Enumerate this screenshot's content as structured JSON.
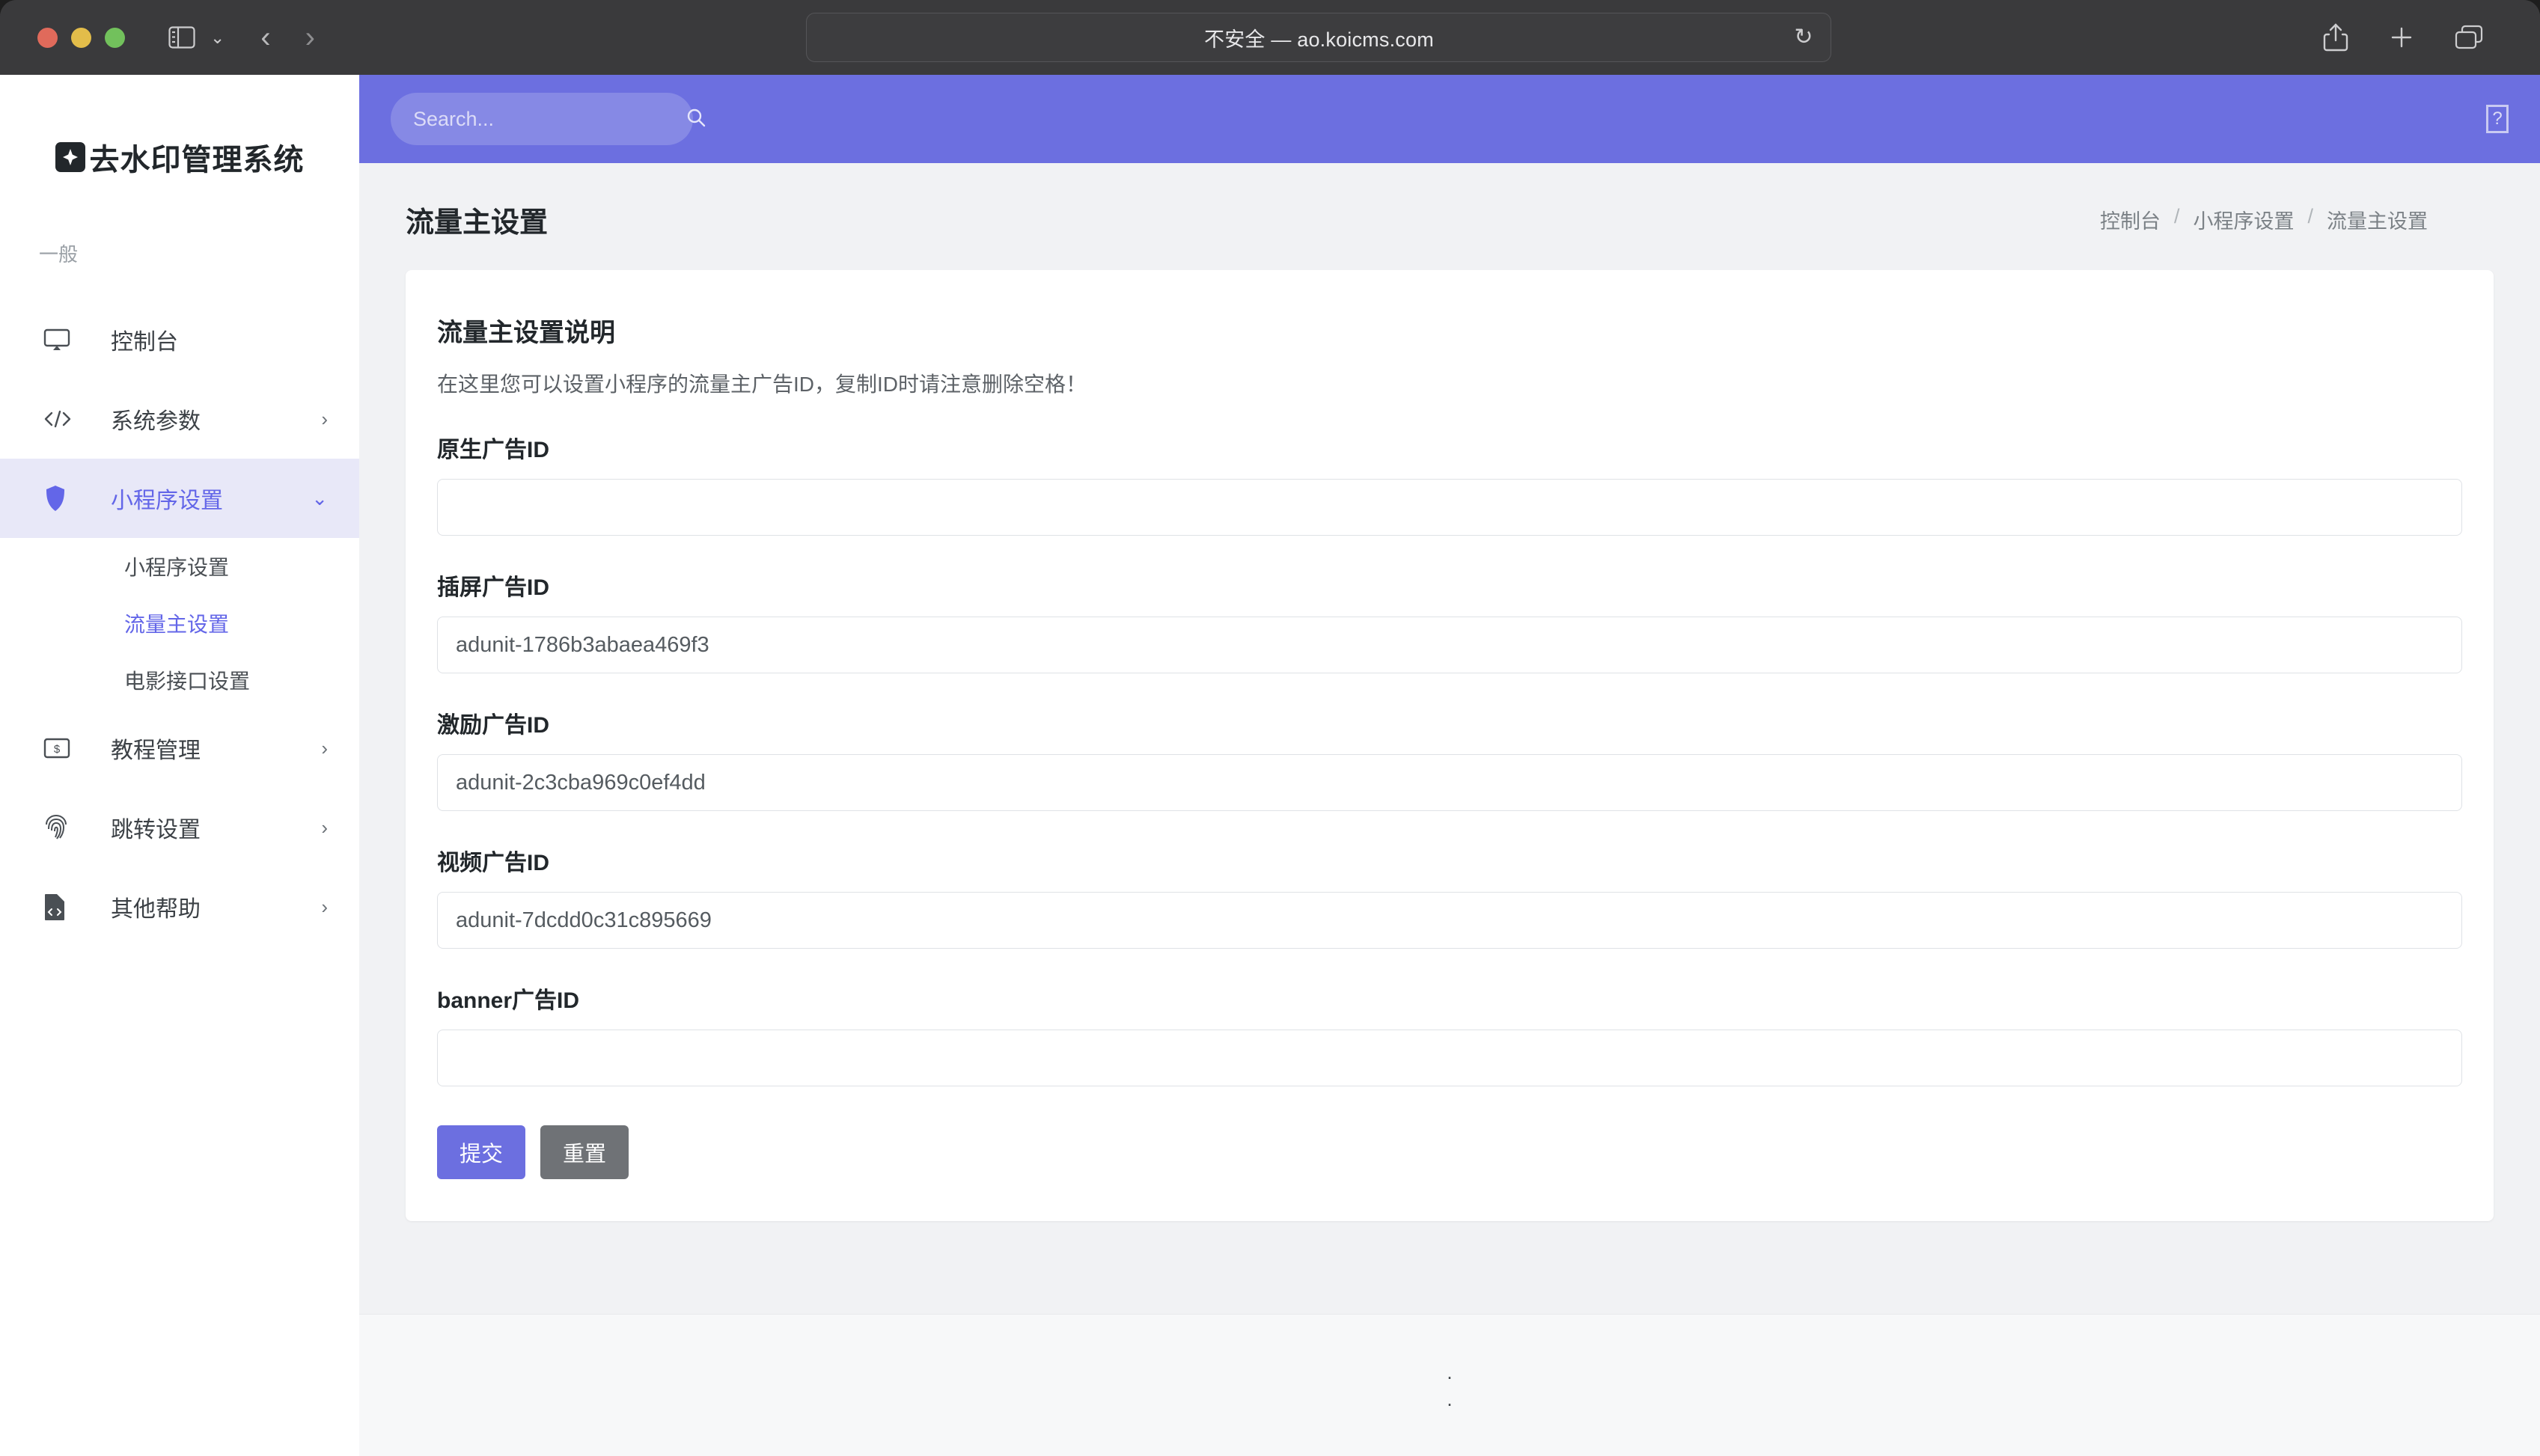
{
  "browser": {
    "url_text": "不安全 — ao.koicms.com",
    "icons": {
      "sidebar_toggle": "sidebar-toggle-icon",
      "chevron_down": "chevron-down-icon",
      "back": "‹",
      "forward": "›",
      "shield": "shield-icon",
      "reload": "↻",
      "share": "share-icon",
      "new_tab": "+",
      "tabs": "tab-overview-icon"
    }
  },
  "sidebar": {
    "brand": "去水印管理系统",
    "section_label": "一般",
    "items": [
      {
        "label": "控制台",
        "icon": "monitor-icon",
        "chevron": "",
        "active": false
      },
      {
        "label": "系统参数",
        "icon": "code-icon",
        "chevron": "›",
        "active": false
      },
      {
        "label": "小程序设置",
        "icon": "shield-icon",
        "chevron": "⌄",
        "active": true
      }
    ],
    "subitems": [
      {
        "label": "小程序设置",
        "active": false
      },
      {
        "label": "流量主设置",
        "active": true
      },
      {
        "label": "电影接口设置",
        "active": false
      }
    ],
    "items_after": [
      {
        "label": "教程管理",
        "icon": "money-card-icon",
        "chevron": "›",
        "active": false
      },
      {
        "label": "跳转设置",
        "icon": "fingerprint-icon",
        "chevron": "›",
        "active": false
      },
      {
        "label": "其他帮助",
        "icon": "file-code-icon",
        "chevron": "›",
        "active": false
      }
    ]
  },
  "topbar": {
    "search_placeholder": "Search...",
    "search_value": "",
    "missing_glyph": "?"
  },
  "header": {
    "title": "流量主设置",
    "breadcrumb": [
      "控制台",
      "小程序设置",
      "流量主设置"
    ],
    "breadcrumb_sep": "/"
  },
  "card": {
    "title": "流量主设置说明",
    "description": "在这里您可以设置小程序的流量主广告ID，复制ID时请注意删除空格！",
    "fields": [
      {
        "label": "原生广告ID",
        "value": "",
        "placeholder": ""
      },
      {
        "label": "插屏广告ID",
        "value": "adunit-1786b3abaea469f3",
        "placeholder": ""
      },
      {
        "label": "激励广告ID",
        "value": "adunit-2c3cba969c0ef4dd",
        "placeholder": ""
      },
      {
        "label": "视频广告ID",
        "value": "adunit-7dcdd0c31c895669",
        "placeholder": ""
      },
      {
        "label": "banner广告ID",
        "value": "",
        "placeholder": ""
      }
    ],
    "submit_label": "提交",
    "reset_label": "重置"
  },
  "footer": {
    "line1": ".",
    "line2": "."
  },
  "colors": {
    "accent": "#6c6fe0",
    "accent_soft": "#e8e8f8",
    "page_bg": "#f1f2f4",
    "secondary_button": "#6f7276"
  }
}
